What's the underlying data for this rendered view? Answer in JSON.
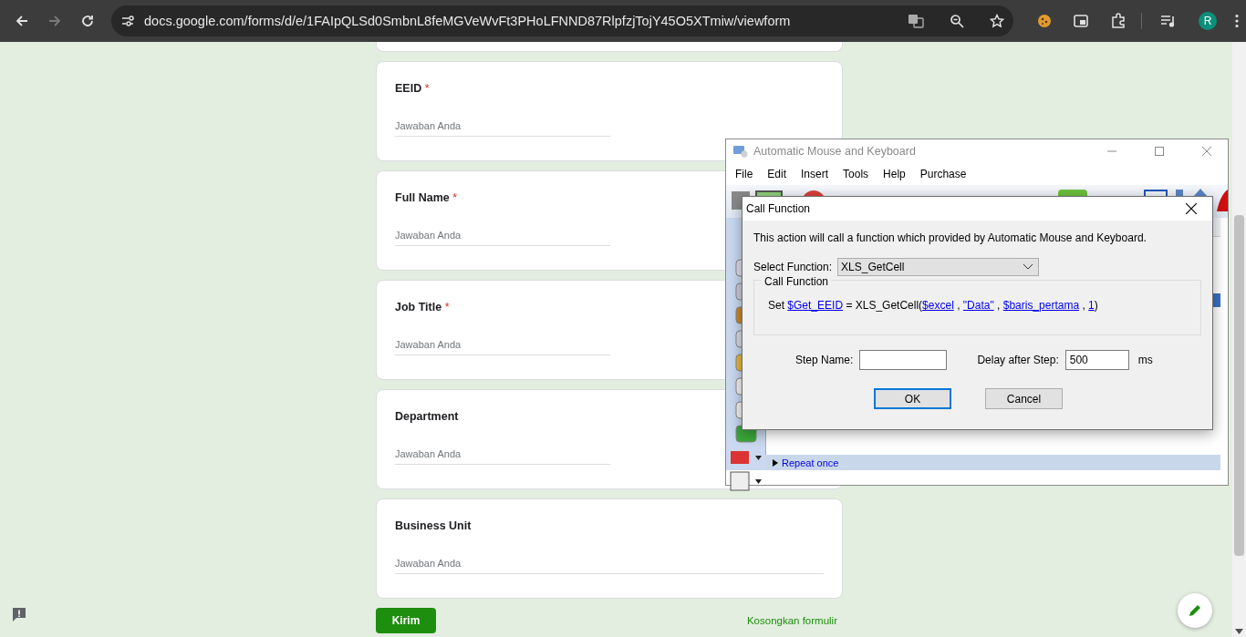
{
  "browser": {
    "url": "docs.google.com/forms/d/e/1FAIpQLSd0SmbnL8feMGVeWvFt3PHoLFNND87RlpfzjTojY45O5XTmiw/viewform",
    "forward_disabled": true,
    "profile_initial": "R"
  },
  "form": {
    "questions": [
      {
        "label": "EEID",
        "mark": "*",
        "placeholder": "Jawaban Anda",
        "wide": false
      },
      {
        "label": "Full Name",
        "mark": "*",
        "placeholder": "Jawaban Anda",
        "wide": false
      },
      {
        "label": "Job Title",
        "mark": "*",
        "placeholder": "Jawaban Anda",
        "wide": false
      },
      {
        "label": "Department",
        "placeholder": "Jawaban Anda",
        "wide": false
      },
      {
        "label": "Business Unit",
        "placeholder": "Jawaban Anda",
        "wide": true
      }
    ],
    "submit": "Kirim",
    "clear": "Kosongkan formulir"
  },
  "app_window": {
    "title": "Automatic Mouse and Keyboard",
    "menu": [
      "File",
      "Edit",
      "Insert",
      "Tools",
      "Help",
      "Purchase"
    ],
    "repeat": "Repeat once"
  },
  "dialog": {
    "title": "Call Function",
    "description": "This action will call a function which provided by Automatic Mouse and Keyboard.",
    "select_label": "Select Function:",
    "select_value": "XLS_GetCell",
    "group_title": "Call Function",
    "call": [
      {
        "text": "Set ",
        "kind": "text"
      },
      {
        "text": "$Get_EEID",
        "kind": "link"
      },
      {
        "text": " = XLS_GetCell(",
        "kind": "text"
      },
      {
        "text": "$excel",
        "kind": "link"
      },
      {
        "text": " , ",
        "kind": "text"
      },
      {
        "text": "\"Data\"",
        "kind": "link"
      },
      {
        "text": " , ",
        "kind": "text"
      },
      {
        "text": "$baris_pertama",
        "kind": "link"
      },
      {
        "text": " , ",
        "kind": "text"
      },
      {
        "text": "1",
        "kind": "link"
      },
      {
        "text": ")",
        "kind": "text"
      }
    ],
    "step_name_label": "Step Name:",
    "delay_label": "Delay after Step:",
    "delay_value": "500",
    "delay_unit": "ms",
    "ok": "OK",
    "cancel": "Cancel"
  }
}
